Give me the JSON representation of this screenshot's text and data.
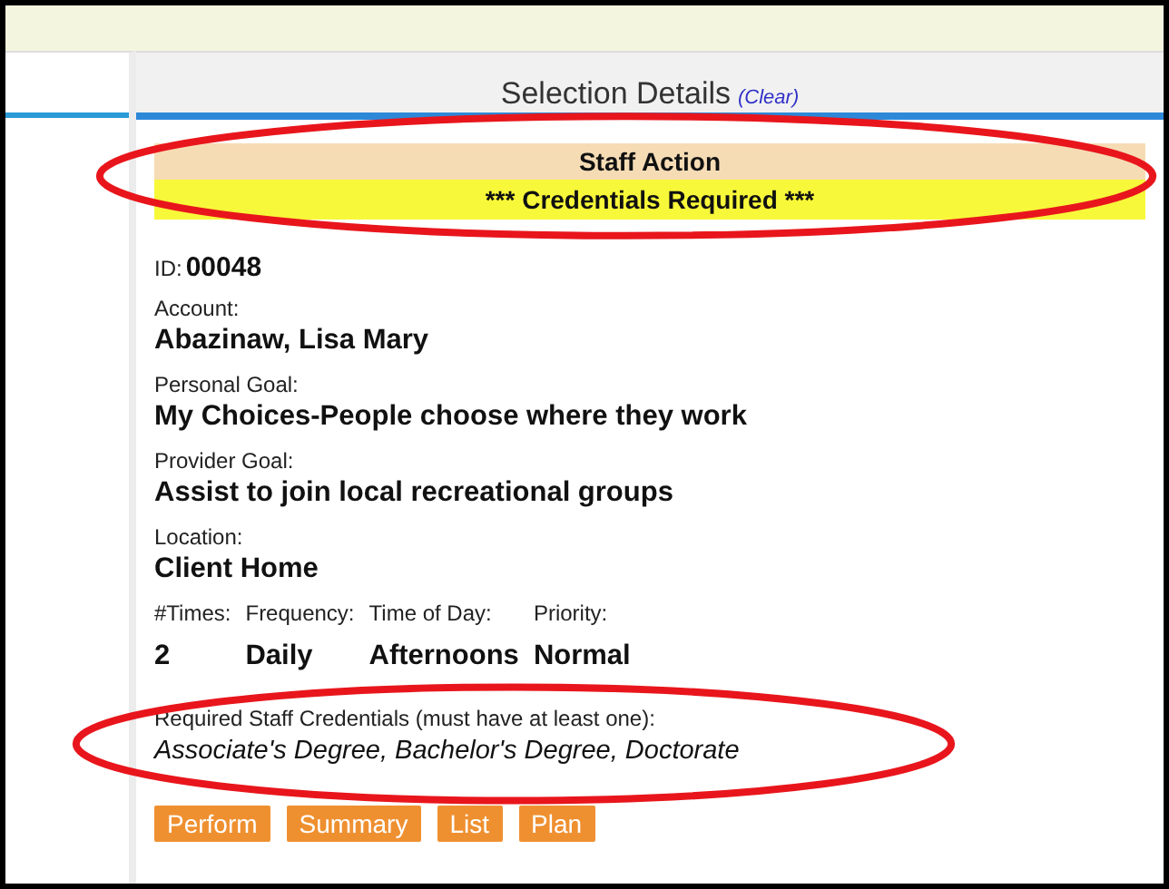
{
  "panel": {
    "title": "Selection Details",
    "clear_link": "(Clear)"
  },
  "banner": {
    "highlighted": true,
    "title": "Staff Action",
    "notice": "*** Credentials Required ***"
  },
  "id": {
    "label": "ID:",
    "value": "00048"
  },
  "fields": [
    {
      "label": "Account:",
      "value": "Abazinaw, Lisa Mary"
    },
    {
      "label": "Personal Goal:",
      "value": "My Choices-People choose where they work"
    },
    {
      "label": "Provider Goal:",
      "value": "Assist to join local recreational groups"
    },
    {
      "label": "Location:",
      "value": "Client Home"
    }
  ],
  "details": [
    {
      "label": "#Times:",
      "value": "2"
    },
    {
      "label": "Frequency:",
      "value": "Daily"
    },
    {
      "label": "Time of Day:",
      "value": "Afternoons"
    },
    {
      "label": "Priority:",
      "value": "Normal"
    }
  ],
  "credentials": {
    "highlighted": true,
    "label": "Required Staff Credentials (must have at least one):",
    "value": "Associate's Degree, Bachelor's Degree, Doctorate"
  },
  "buttons": [
    "Perform",
    "Summary",
    "List",
    "Plan"
  ]
}
